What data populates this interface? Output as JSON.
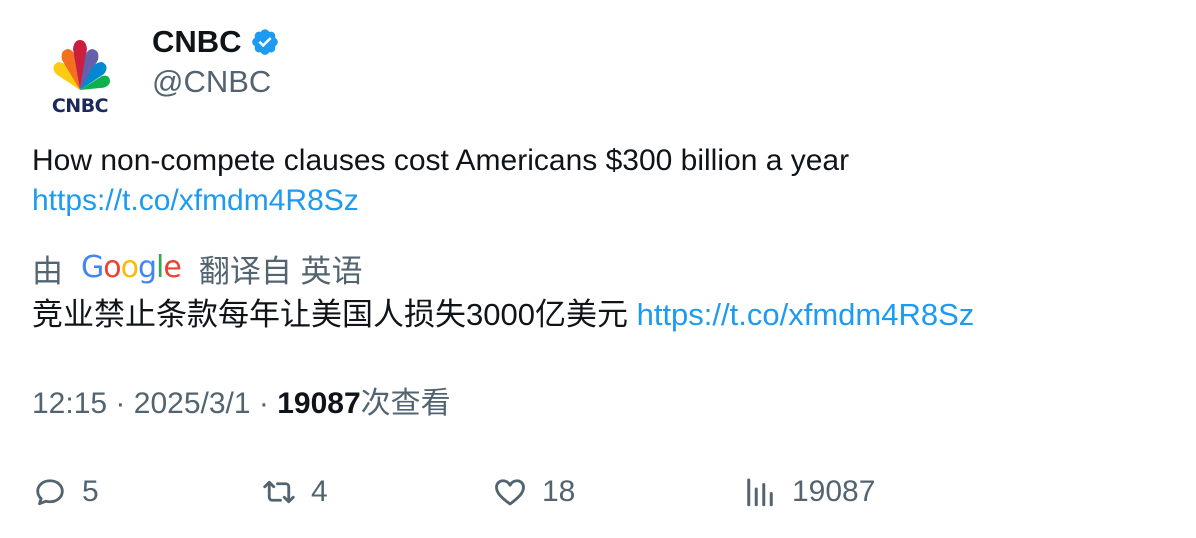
{
  "account": {
    "display_name": "CNBC",
    "handle": "@CNBC",
    "avatar_wordmark": "CNBC",
    "verified": true
  },
  "tweet": {
    "text": "How non-compete clauses cost Americans $300 billion a year",
    "link": "https://t.co/xfmdm4R8Sz"
  },
  "translation": {
    "by_label": "由",
    "provider": "Google",
    "from_label": "翻译自 英语",
    "text": "竞业禁止条款每年让美国人损失3000亿美元",
    "link": "https://t.co/xfmdm4R8Sz"
  },
  "meta": {
    "time": "12:15",
    "separator": "·",
    "date": "2025/3/1",
    "views_count": "19087",
    "views_label": "次查看"
  },
  "actions": {
    "replies": "5",
    "retweets": "4",
    "likes": "18",
    "views": "19087"
  },
  "colors": {
    "link": "#1d9bf0",
    "verified": "#1d9bf0",
    "secondary_text": "#536471",
    "primary_text": "#0f1419"
  },
  "icons": {
    "reply": "reply-icon",
    "retweet": "retweet-icon",
    "like": "like-icon",
    "views": "views-icon",
    "verified": "verified-badge-icon"
  }
}
